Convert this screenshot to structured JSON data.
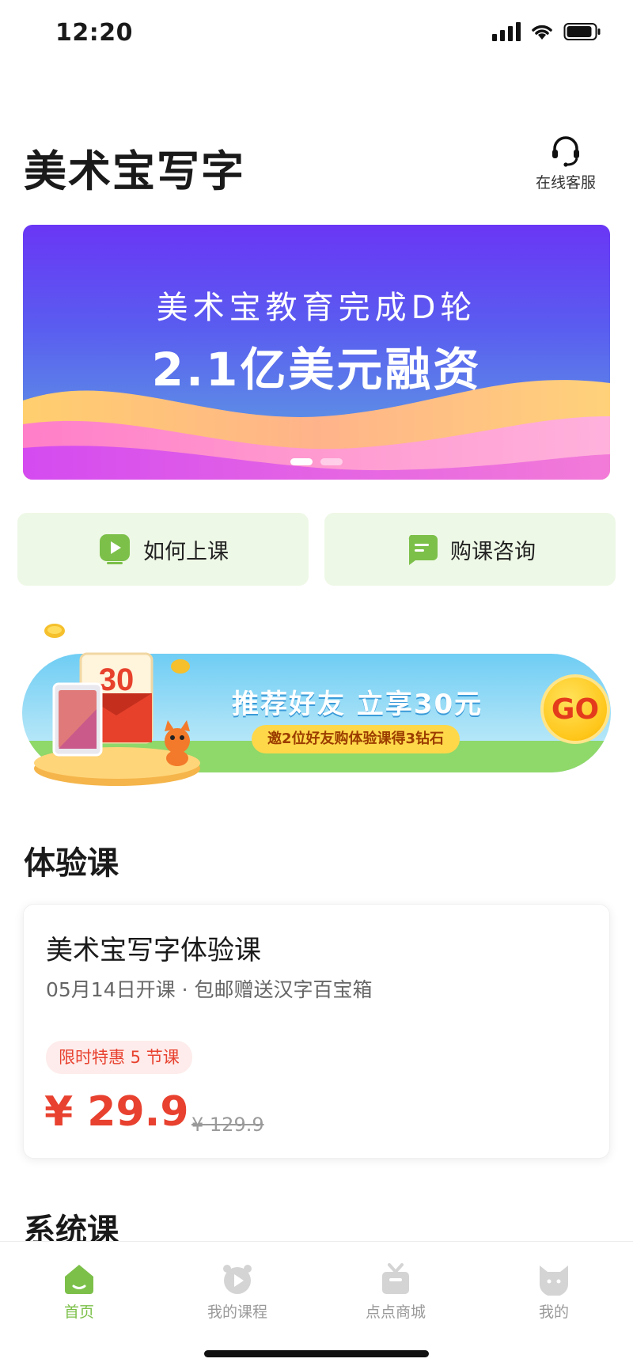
{
  "status_bar": {
    "time": "12:20"
  },
  "header": {
    "title": "美术宝写字",
    "service_label": "在线客服"
  },
  "banner": {
    "line1": "美术宝教育完成D轮",
    "line2": "2.1亿美元融资",
    "slide_count": 2,
    "active_slide": 1
  },
  "quick_actions": [
    {
      "label": "如何上课",
      "icon": "play-icon"
    },
    {
      "label": "购课咨询",
      "icon": "chat-icon"
    }
  ],
  "referral": {
    "badge_number": "30",
    "title": "推荐好友  立享30元",
    "subtitle": "邀2位好友购体验课得3钻石",
    "go_label": "GO"
  },
  "trial_section": {
    "title": "体验课",
    "course": {
      "title": "美术宝写字体验课",
      "subtitle": "05月14日开课 · 包邮赠送汉字百宝箱",
      "promo_tag": "限时特惠 5 节课",
      "price": "¥ 29.9",
      "original_price": "¥ 129.9"
    }
  },
  "system_section": {
    "title": "系统课"
  },
  "tab_bar": {
    "tabs": [
      {
        "label": "首页",
        "icon": "home-icon",
        "active": true
      },
      {
        "label": "我的课程",
        "icon": "course-icon",
        "active": false
      },
      {
        "label": "点点商城",
        "icon": "shop-icon",
        "active": false
      },
      {
        "label": "我的",
        "icon": "profile-icon",
        "active": false
      }
    ]
  },
  "colors": {
    "accent_green": "#7cc04a",
    "price_red": "#e8412f",
    "banner_purple": "#6a36f5"
  }
}
